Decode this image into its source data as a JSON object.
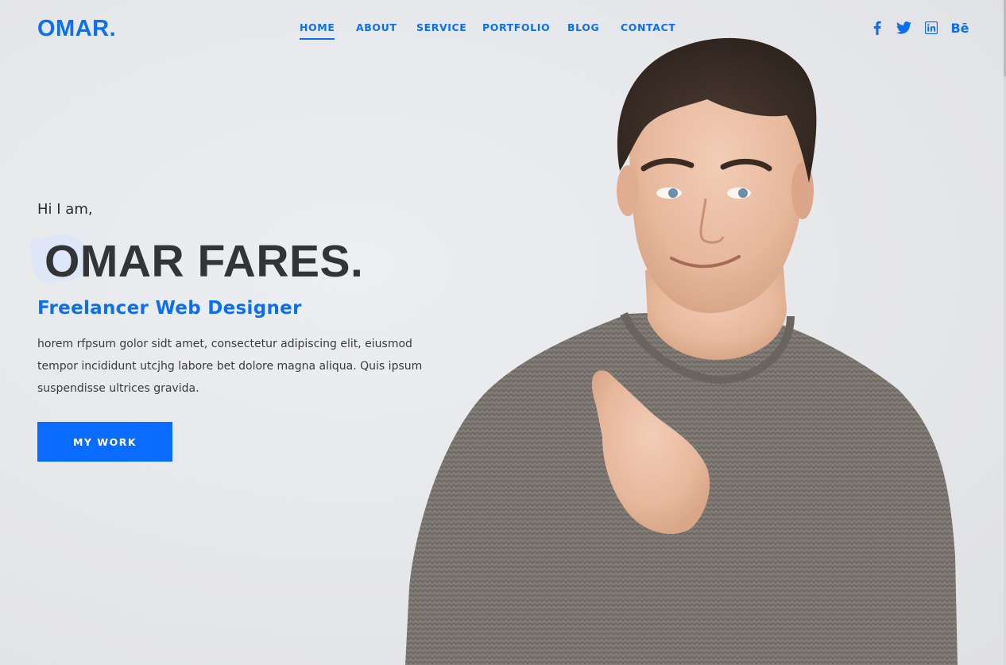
{
  "brand": {
    "logo_text": "OMAR."
  },
  "nav": {
    "items": [
      {
        "label": "HOME",
        "active": true
      },
      {
        "label": "ABOUT",
        "active": false
      },
      {
        "label": "SERVICE",
        "active": false
      },
      {
        "label": "PORTFOLIO",
        "active": false
      },
      {
        "label": "BLOG",
        "active": false
      },
      {
        "label": "CONTACT",
        "active": false
      }
    ]
  },
  "social": {
    "items": [
      {
        "icon": "facebook-icon",
        "glyph": "f"
      },
      {
        "icon": "twitter-icon",
        "glyph": ""
      },
      {
        "icon": "linkedin-icon",
        "glyph": "in"
      },
      {
        "icon": "behance-icon",
        "glyph": "Bē"
      }
    ]
  },
  "hero": {
    "greeting": "Hi I am,",
    "name": "OMAR FARES.",
    "role": "Freelancer Web Designer",
    "bio": "horem rfpsum golor sidt amet, consectetur adipiscing elit, eiusmod tempor incididunt utcjhg labore bet dolore magna aliqua. Quis ipsum suspendisse ultrices gravida.",
    "cta_label": "MY WORK"
  },
  "colors": {
    "accent": "#0b6ff0",
    "button": "#0a6cff",
    "text_dark": "#333435",
    "background": "#e6e7ea"
  }
}
